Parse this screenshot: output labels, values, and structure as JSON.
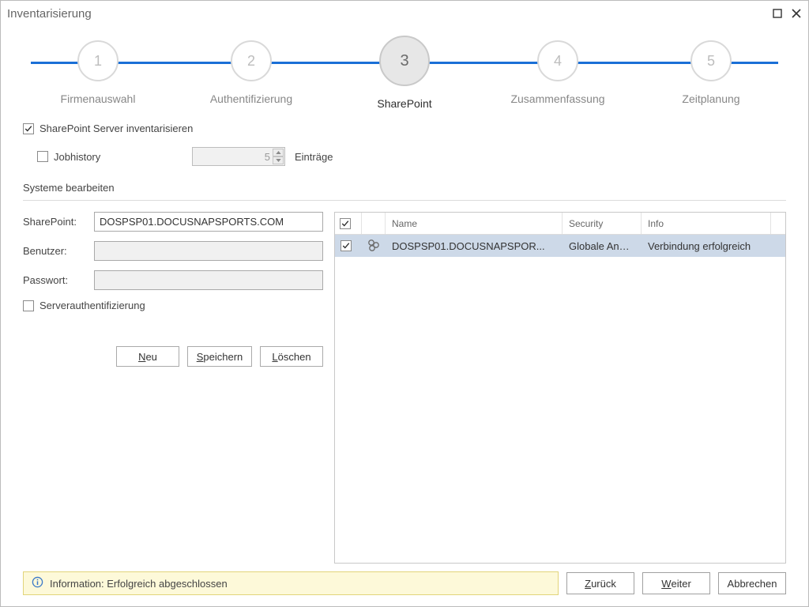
{
  "title": "Inventarisierung",
  "steps": [
    {
      "num": "1",
      "label": "Firmenauswahl"
    },
    {
      "num": "2",
      "label": "Authentifizierung"
    },
    {
      "num": "3",
      "label": "SharePoint"
    },
    {
      "num": "4",
      "label": "Zusammenfassung"
    },
    {
      "num": "5",
      "label": "Zeitplanung"
    }
  ],
  "options": {
    "inventory_sharepoint_label": "SharePoint Server inventarisieren",
    "jobhistory_label": "Jobhistory",
    "jobhistory_value": "5",
    "entries_label": "Einträge"
  },
  "systems_section_title": "Systeme bearbeiten",
  "form": {
    "sharepoint_label": "SharePoint:",
    "sharepoint_value": "DOSPSP01.DOCUSNAPSPORTS.COM",
    "user_label": "Benutzer:",
    "user_value": "",
    "password_label": "Passwort:",
    "password_value": "",
    "serverauth_label": "Serverauthentifizierung",
    "btn_new": "Neu",
    "btn_new_ul": "N",
    "btn_save": "Speichern",
    "btn_save_ul": "S",
    "btn_delete": "Löschen",
    "btn_delete_ul": "L"
  },
  "table": {
    "headers": {
      "name": "Name",
      "security": "Security",
      "info": "Info"
    },
    "rows": [
      {
        "name": "DOSPSP01.DOCUSNAPSPOR...",
        "security": "Globale Anm...",
        "info": "Verbindung erfolgreich"
      }
    ]
  },
  "footer": {
    "info_text": "Information: Erfolgreich abgeschlossen",
    "btn_back": "Zurück",
    "btn_back_ul": "Z",
    "btn_next": "Weiter",
    "btn_next_ul": "W",
    "btn_cancel": "Abbrechen"
  }
}
